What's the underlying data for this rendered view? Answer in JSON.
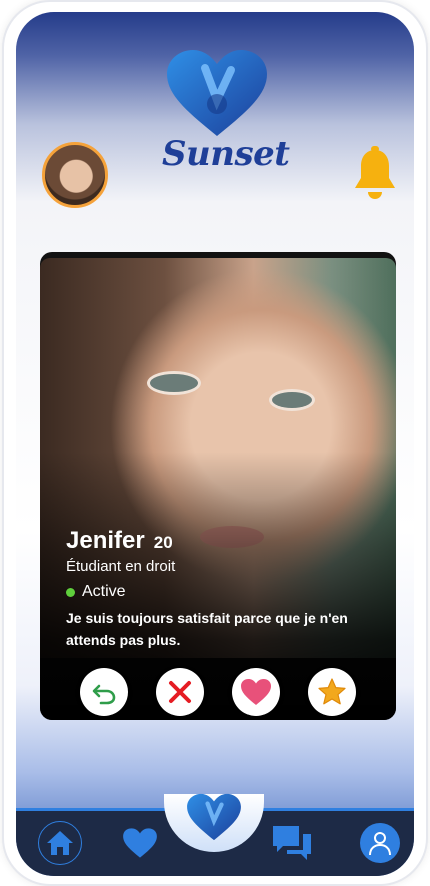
{
  "app": {
    "brand_name": "Sunset",
    "brand_color": "#1f3f98",
    "accent_color": "#f5a23a"
  },
  "header": {
    "avatar_icon": "user-avatar",
    "notification_icon": "bell-icon"
  },
  "profile": {
    "name": "Jenifer",
    "age": "20",
    "occupation": "Étudiant en droit",
    "status": "Active",
    "status_color": "#5fcf3c",
    "bio": "Je suis toujours satisfait parce que je n'en attends pas plus."
  },
  "actions": [
    {
      "id": "undo",
      "icon": "undo-arrow-icon",
      "color": "#2f9d4a"
    },
    {
      "id": "dislike",
      "icon": "close-x-icon",
      "color": "#e51c23"
    },
    {
      "id": "like",
      "icon": "heart-icon",
      "color": "#e8517a"
    },
    {
      "id": "superlike",
      "icon": "star-icon",
      "color": "#f2a81d"
    }
  ],
  "bottom_nav": {
    "items": [
      {
        "id": "home",
        "icon": "home-icon"
      },
      {
        "id": "favorites",
        "icon": "heart-icon"
      },
      {
        "id": "center",
        "icon": "sunset-logo-icon"
      },
      {
        "id": "messages",
        "icon": "chat-icon"
      },
      {
        "id": "profile",
        "icon": "user-icon"
      }
    ],
    "color": "#2f7fe0"
  }
}
